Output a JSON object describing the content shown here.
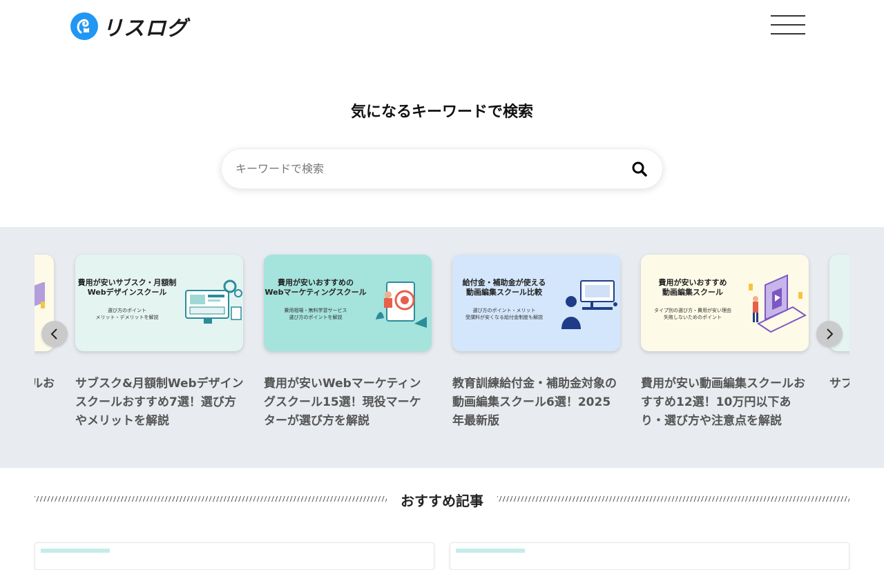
{
  "header": {
    "logo_text": "リスログ"
  },
  "search": {
    "heading": "気になるキーワードで検索",
    "placeholder": "キーワードで検索"
  },
  "carousel": {
    "partial_left_title": "ルお",
    "slides": [
      {
        "thumb_title": "費用が安いサブスク・月額制\nWebデザインスクール",
        "thumb_sub": "選び方のポイント\nメリット・デメリットを解説",
        "thumb_bg": "#e4f4f1",
        "title": "サブスク&月額制Webデザインスクールおすすめ7選！選び方やメリットを解説"
      },
      {
        "thumb_title": "費用が安いおすすめの\nWebマーケティングスクール",
        "thumb_sub": "費用相場・無料学習サービス\n選び方のポイントを解説",
        "thumb_bg": "#a5e3dd",
        "title": "費用が安いWebマーケティングスクール15選！現役マーケターが選び方を解説"
      },
      {
        "thumb_title": "給付金・補助金が使える\n動画編集スクール比較",
        "thumb_sub": "選び方のポイント・メリット\n受講料が安くなる給付金制度も解説",
        "thumb_bg": "#d4e6fb",
        "title": "教育訓練給付金・補助金対象の動画編集スクール6選！2025年最新版"
      },
      {
        "thumb_title": "費用が安いおすすめ\n動画編集スクール",
        "thumb_sub": "タイプ別の選び方・費用が安い理由\n失敗しないためのポイント",
        "thumb_bg": "#fdfbe8",
        "title": "費用が安い動画編集スクールおすすめ12選！10万円以下あり・選び方や注意点を解説"
      }
    ],
    "partial_right_title": "サブスクや"
  },
  "recommended": {
    "heading": "おすすめ記事"
  },
  "colors": {
    "logo_blue": "#2196f3",
    "carousel_bg": "#e8ebef"
  },
  "icons": {
    "menu": "hamburger-icon",
    "search": "search-icon",
    "prev": "chevron-left-icon",
    "next": "chevron-right-icon"
  }
}
